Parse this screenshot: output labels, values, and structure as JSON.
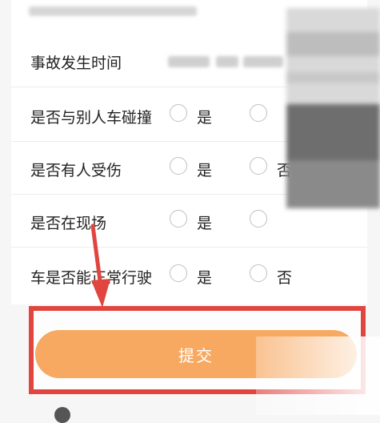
{
  "form": {
    "fields": [
      {
        "label": "事故发生时间"
      },
      {
        "label": "是否与别人车碰撞",
        "option_yes": "是",
        "option_no": ""
      },
      {
        "label": "是否有人受伤",
        "option_yes": "是",
        "option_no": "否"
      },
      {
        "label": "是否在现场",
        "option_yes": "是",
        "option_no": ""
      },
      {
        "label": "车是否能正常行驶",
        "option_yes": "是",
        "option_no": "否"
      }
    ]
  },
  "submit": {
    "label": "提交"
  },
  "colors": {
    "accent_orange": "#f7a962",
    "annotation_red": "#e0463f"
  }
}
